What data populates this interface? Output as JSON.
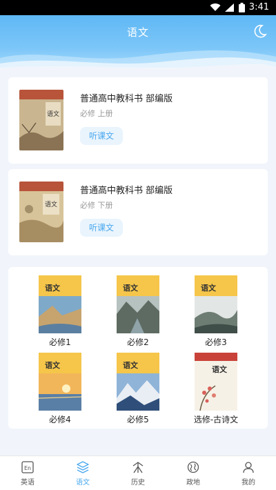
{
  "status": {
    "time": "3:41"
  },
  "header": {
    "title": "语文"
  },
  "books": [
    {
      "name": "普通高中教科书 部编版",
      "sub": "必修 上册",
      "button": "听课文"
    },
    {
      "name": "普通高中教科书 部编版",
      "sub": "必修 下册",
      "button": "听课文"
    }
  ],
  "grid": [
    {
      "label": "必修1"
    },
    {
      "label": "必修2"
    },
    {
      "label": "必修3"
    },
    {
      "label": "必修4"
    },
    {
      "label": "必修5"
    },
    {
      "label": "选修-古诗文"
    }
  ],
  "nav": [
    {
      "label": "英语",
      "icon": "english-icon"
    },
    {
      "label": "语文",
      "icon": "layers-icon",
      "active": true
    },
    {
      "label": "历史",
      "icon": "history-icon"
    },
    {
      "label": "政地",
      "icon": "globe-icon"
    },
    {
      "label": "我的",
      "icon": "person-icon"
    }
  ],
  "colors": {
    "accent": "#4aa8ee",
    "header": "#6ebff7",
    "background": "#f1f5fb"
  }
}
